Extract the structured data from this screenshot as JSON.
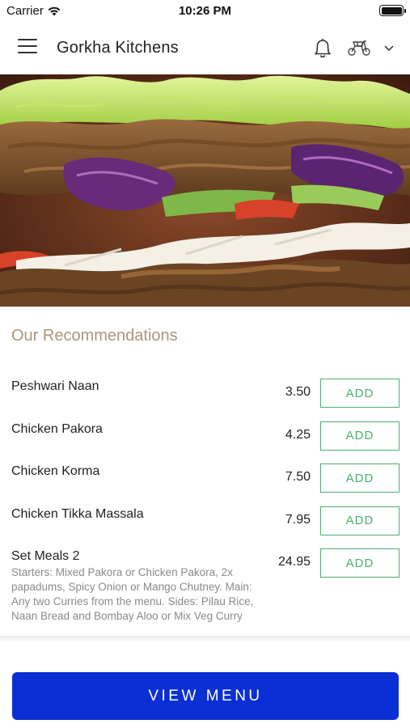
{
  "status_bar": {
    "carrier": "Carrier",
    "time": "10:26 PM",
    "wifi_icon": "wifi-icon",
    "battery_icon": "battery-icon"
  },
  "header": {
    "title": "Gorkha Kitchens",
    "menu_icon": "hamburger-menu-icon",
    "notification_icon": "bell-icon",
    "delivery_icon": "scooter-icon",
    "dropdown_icon": "chevron-down-icon"
  },
  "hero": {
    "image": "doner-kebab-food-photo"
  },
  "recommendations": {
    "title": "Our Recommendations",
    "add_label": "ADD",
    "items": [
      {
        "name": "Peshwari Naan",
        "price": "3.50",
        "description": ""
      },
      {
        "name": "Chicken Pakora",
        "price": "4.25",
        "description": ""
      },
      {
        "name": "Chicken Korma",
        "price": "7.50",
        "description": ""
      },
      {
        "name": "Chicken Tikka Massala",
        "price": "7.95",
        "description": ""
      },
      {
        "name": "Set Meals 2",
        "price": "24.95",
        "description": "Starters: Mixed Pakora or Chicken Pakora, 2x papadums, Spicy Onion or Mango Chutney. Main: Any two Curries from the menu. Sides: Pilau Rice, Naan Bread and Bombay Aloo or Mix Veg Curry"
      }
    ]
  },
  "footer": {
    "view_menu_label": "VIEW MENU"
  },
  "colors": {
    "accent_blue": "#0a2fd4",
    "add_green": "#4caf6d",
    "section_title": "#a8977a"
  }
}
